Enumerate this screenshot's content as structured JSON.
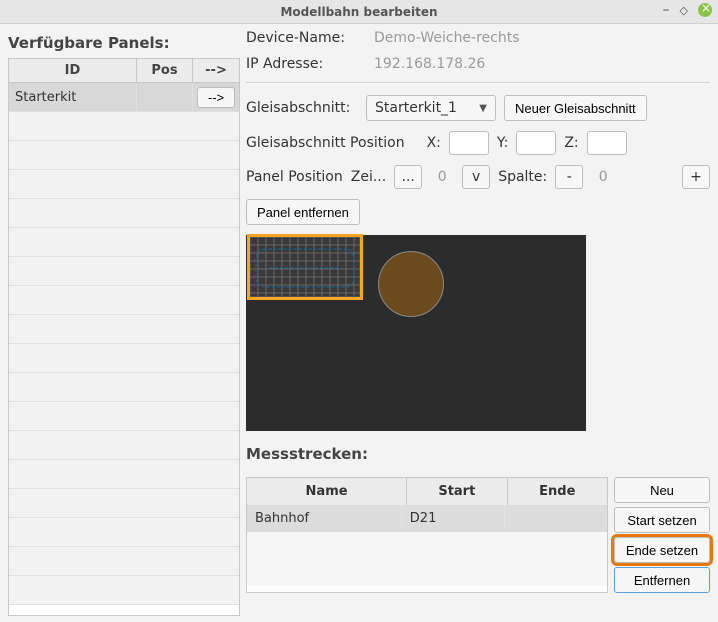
{
  "window": {
    "title": "Modellbahn bearbeiten"
  },
  "left": {
    "title": "Verfügbare Panels:",
    "columns": {
      "id": "ID",
      "pos": "Pos",
      "go": "-->"
    },
    "rows": [
      {
        "id": "Starterkit",
        "pos": "",
        "go": "-->"
      }
    ]
  },
  "right": {
    "device_name_label": "Device-Name:",
    "device_name_value": "Demo-Weiche-rechts",
    "ip_label": "IP Adresse:",
    "ip_value": "192.168.178.26",
    "section_label": "Gleisabschnitt:",
    "section_selected": "Starterkit_1",
    "new_section_btn": "Neuer Gleisabschnitt",
    "section_pos_label": "Gleisabschnitt Position",
    "x_label": "X:",
    "y_label": "Y:",
    "z_label": "Z:",
    "panel_pos_label": "Panel Position",
    "row_label_trunc": "Zei...",
    "row_btn": "...",
    "row_value": "0",
    "v_btn": "v",
    "col_label": "Spalte:",
    "col_minus": "-",
    "col_value": "0",
    "col_plus": "+",
    "remove_panel_btn": "Panel entfernen"
  },
  "mess": {
    "title": "Messstrecken:",
    "columns": {
      "name": "Name",
      "start": "Start",
      "end": "Ende"
    },
    "rows": [
      {
        "name": "Bahnhof",
        "start": "D21",
        "end": ""
      }
    ],
    "buttons": {
      "new": "Neu",
      "set_start": "Start setzen",
      "set_end": "Ende setzen",
      "remove": "Entfernen"
    }
  }
}
